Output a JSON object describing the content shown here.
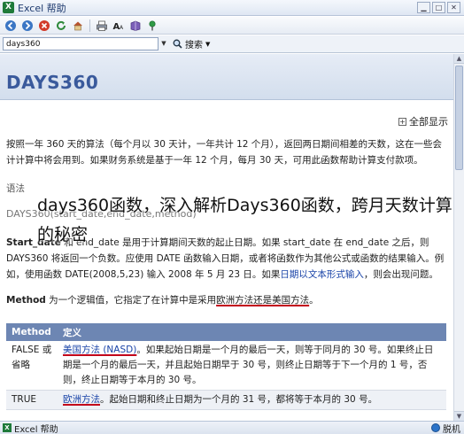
{
  "window": {
    "title": "Excel 帮助"
  },
  "search": {
    "value": "days360",
    "button_label": "搜索"
  },
  "article": {
    "title": "DAYS360",
    "show_all": "全部显示",
    "intro": "按照一年 360 天的算法（每个月以 30 天计，一年共计 12 个月），返回两日期间相差的天数，这在一些会计计算中将会用到。如果财务系统是基于一年 12 个月，每月 30 天，可用此函数帮助计算支付款项。",
    "syntax_label": "语法",
    "syntax_code": "DAYS360(start_date,end_date,method)",
    "p2_prefix": "Start_date",
    "p2_text": "和 end_date 是用于计算期间天数的起止日期。如果 start_date 在 end_date 之后，则 DAYS360 将返回一个负数。应使用 DATE 函数输入日期，或者将函数作为其他公式或函数的结果输入。例如，使用函数 DATE(2008,5,23) 输入 2008 年 5 月 23 日。如果",
    "p2_link": "日期以文本形式输入",
    "p2_suffix": "，则会出现问题。",
    "p3_label": "Method",
    "p3_text": "为一个逻辑值，它指定了在计算中是采用",
    "p3_highlight": "欧洲方法还是美国方法",
    "p3_end": "。"
  },
  "table": {
    "headers": [
      "Method",
      "定义"
    ],
    "rows": [
      {
        "method": "FALSE 或省略",
        "def_highlight": "美国方法 (NASD)",
        "def_text": "。如果起始日期是一个月的最后一天，则等于同月的 30 号。如果终止日期是一个月的最后一天，并且起始日期早于 30 号，则终止日期等于下一个月的 1 号，否则，终止日期等于本月的 30 号。"
      },
      {
        "method": "TRUE",
        "def_highlight": "欧洲方法",
        "def_text": "。起始日期和终止日期为一个月的 31 号，都将等于本月的 30 号。"
      }
    ]
  },
  "overlay_text": "days360函数，深入解析Days360函数，跨月天数计算的秘密",
  "status": {
    "left": "Excel 帮助",
    "right": "脱机"
  },
  "icons": {
    "back": "back-icon",
    "forward": "forward-icon",
    "stop": "stop-icon",
    "refresh": "refresh-icon",
    "home": "home-icon",
    "print": "print-icon",
    "font_size": "font-size-icon",
    "book": "book-icon",
    "pin": "pin-icon"
  }
}
